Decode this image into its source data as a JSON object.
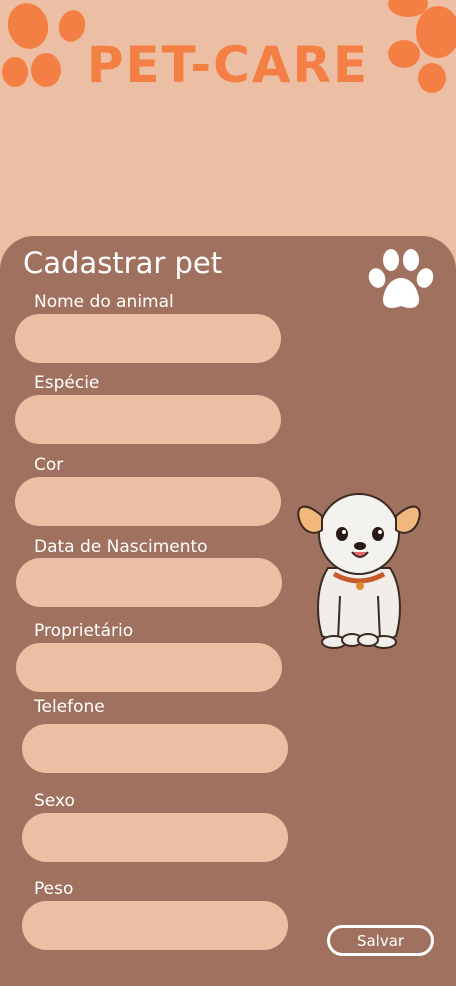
{
  "app": {
    "title": "PET-CARE"
  },
  "form": {
    "title": "Cadastrar pet",
    "fields": [
      {
        "label": "Nome do animal",
        "value": ""
      },
      {
        "label": "Espécie",
        "value": ""
      },
      {
        "label": "Cor",
        "value": ""
      },
      {
        "label": "Data de Nascimento",
        "value": ""
      },
      {
        "label": "Proprietário",
        "value": ""
      },
      {
        "label": "Telefone",
        "value": ""
      },
      {
        "label": "Sexo",
        "value": ""
      },
      {
        "label": "Peso",
        "value": ""
      }
    ],
    "save_label": "Salvar"
  },
  "icons": {
    "header_left": "paw-icon",
    "header_right": "paw-icon",
    "panel": "paw-icon",
    "illustration": "dog-illustration"
  },
  "colors": {
    "background": "#ecbfa4",
    "panel": "#a0715e",
    "accent": "#f47f45",
    "input": "#ecbfa4",
    "text": "#ffffff"
  }
}
